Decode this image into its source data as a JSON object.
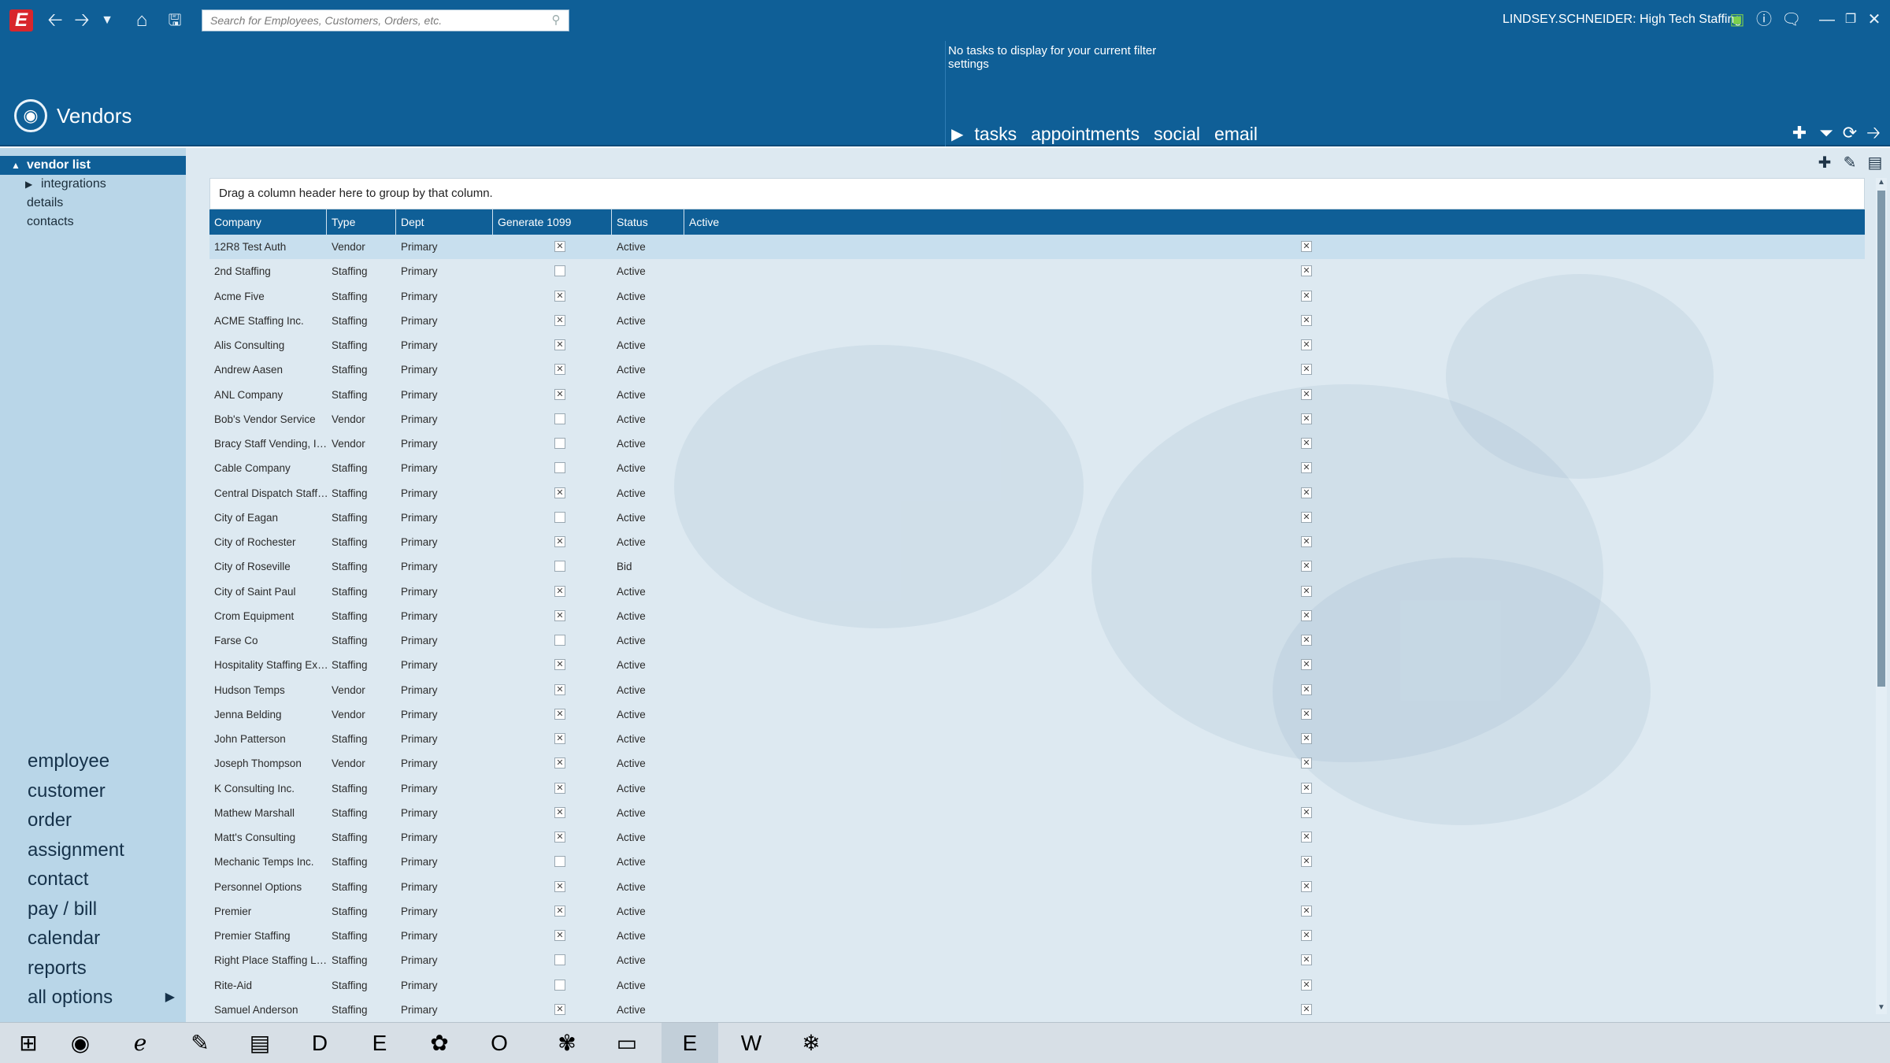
{
  "window": {
    "app_logo": "E",
    "search_placeholder": "Search for Employees, Customers, Orders, etc.",
    "user": "LINDSEY.SCHNEIDER: High Tech Staffing"
  },
  "module": {
    "title": "Vendors"
  },
  "tasks_panel": {
    "message": "No tasks to display for your current filter settings",
    "tabs": [
      "tasks",
      "appointments",
      "social",
      "email"
    ]
  },
  "tree": [
    {
      "label": "vendor list",
      "selected": true,
      "arrow": "▲"
    },
    {
      "label": "integrations",
      "selected": false,
      "arrow": "▶"
    },
    {
      "label": "details",
      "selected": false,
      "arrow": ""
    },
    {
      "label": "contacts",
      "selected": false,
      "arrow": ""
    }
  ],
  "nav": [
    "employee",
    "customer",
    "order",
    "assignment",
    "contact",
    "pay / bill",
    "calendar",
    "reports",
    "all options"
  ],
  "grid": {
    "group_hint": "Drag a column header here to group by that column.",
    "columns": [
      "Company",
      "Type",
      "Dept",
      "Generate 1099",
      "Status",
      "Active"
    ],
    "rows": [
      {
        "company": "12R8 Test Auth",
        "type": "Vendor",
        "dept": "Primary",
        "gen1099": true,
        "status": "Active",
        "active": true
      },
      {
        "company": "2nd Staffing",
        "type": "Staffing",
        "dept": "Primary",
        "gen1099": false,
        "status": "Active",
        "active": true
      },
      {
        "company": "Acme Five",
        "type": "Staffing",
        "dept": "Primary",
        "gen1099": true,
        "status": "Active",
        "active": true
      },
      {
        "company": "ACME Staffing Inc.",
        "type": "Staffing",
        "dept": "Primary",
        "gen1099": true,
        "status": "Active",
        "active": true
      },
      {
        "company": "Alis Consulting",
        "type": "Staffing",
        "dept": "Primary",
        "gen1099": true,
        "status": "Active",
        "active": true
      },
      {
        "company": "Andrew Aasen",
        "type": "Staffing",
        "dept": "Primary",
        "gen1099": true,
        "status": "Active",
        "active": true
      },
      {
        "company": "ANL Company",
        "type": "Staffing",
        "dept": "Primary",
        "gen1099": true,
        "status": "Active",
        "active": true
      },
      {
        "company": "Bob's Vendor Service",
        "type": "Vendor",
        "dept": "Primary",
        "gen1099": false,
        "status": "Active",
        "active": true
      },
      {
        "company": "Bracy Staff Vending, Inc.",
        "type": "Vendor",
        "dept": "Primary",
        "gen1099": false,
        "status": "Active",
        "active": true
      },
      {
        "company": "Cable Company",
        "type": "Staffing",
        "dept": "Primary",
        "gen1099": false,
        "status": "Active",
        "active": true
      },
      {
        "company": "Central Dispatch Staffing",
        "type": "Staffing",
        "dept": "Primary",
        "gen1099": true,
        "status": "Active",
        "active": true
      },
      {
        "company": "City of Eagan",
        "type": "Staffing",
        "dept": "Primary",
        "gen1099": false,
        "status": "Active",
        "active": true
      },
      {
        "company": "City of Rochester",
        "type": "Staffing",
        "dept": "Primary",
        "gen1099": true,
        "status": "Active",
        "active": true
      },
      {
        "company": "City of Roseville",
        "type": "Staffing",
        "dept": "Primary",
        "gen1099": false,
        "status": "Bid",
        "active": true
      },
      {
        "company": "City of Saint Paul",
        "type": "Staffing",
        "dept": "Primary",
        "gen1099": true,
        "status": "Active",
        "active": true
      },
      {
        "company": "Crom Equipment",
        "type": "Staffing",
        "dept": "Primary",
        "gen1099": true,
        "status": "Active",
        "active": true
      },
      {
        "company": "Farse Co",
        "type": "Staffing",
        "dept": "Primary",
        "gen1099": false,
        "status": "Active",
        "active": true
      },
      {
        "company": "Hospitality Staffing Exe...",
        "type": "Staffing",
        "dept": "Primary",
        "gen1099": true,
        "status": "Active",
        "active": true
      },
      {
        "company": "Hudson Temps",
        "type": "Vendor",
        "dept": "Primary",
        "gen1099": true,
        "status": "Active",
        "active": true
      },
      {
        "company": "Jenna Belding",
        "type": "Vendor",
        "dept": "Primary",
        "gen1099": true,
        "status": "Active",
        "active": true
      },
      {
        "company": "John Patterson",
        "type": "Staffing",
        "dept": "Primary",
        "gen1099": true,
        "status": "Active",
        "active": true
      },
      {
        "company": "Joseph Thompson",
        "type": "Vendor",
        "dept": "Primary",
        "gen1099": true,
        "status": "Active",
        "active": true
      },
      {
        "company": "K Consulting Inc.",
        "type": "Staffing",
        "dept": "Primary",
        "gen1099": true,
        "status": "Active",
        "active": true
      },
      {
        "company": "Mathew Marshall",
        "type": "Staffing",
        "dept": "Primary",
        "gen1099": true,
        "status": "Active",
        "active": true
      },
      {
        "company": "Matt's Consulting",
        "type": "Staffing",
        "dept": "Primary",
        "gen1099": true,
        "status": "Active",
        "active": true
      },
      {
        "company": "Mechanic Temps Inc.",
        "type": "Staffing",
        "dept": "Primary",
        "gen1099": false,
        "status": "Active",
        "active": true
      },
      {
        "company": "Personnel Options",
        "type": "Staffing",
        "dept": "Primary",
        "gen1099": true,
        "status": "Active",
        "active": true
      },
      {
        "company": "Premier",
        "type": "Staffing",
        "dept": "Primary",
        "gen1099": true,
        "status": "Active",
        "active": true
      },
      {
        "company": "Premier Staffing",
        "type": "Staffing",
        "dept": "Primary",
        "gen1099": true,
        "status": "Active",
        "active": true
      },
      {
        "company": "Right Place Staffing LLC",
        "type": "Staffing",
        "dept": "Primary",
        "gen1099": false,
        "status": "Active",
        "active": true
      },
      {
        "company": "Rite-Aid",
        "type": "Staffing",
        "dept": "Primary",
        "gen1099": false,
        "status": "Active",
        "active": true
      },
      {
        "company": "Samuel Anderson",
        "type": "Staffing",
        "dept": "Primary",
        "gen1099": true,
        "status": "Active",
        "active": true
      }
    ]
  },
  "taskbar": [
    {
      "name": "start-icon",
      "glyph": "⊞",
      "active": false
    },
    {
      "name": "chrome-icon",
      "glyph": "◉",
      "active": false
    },
    {
      "name": "internet-explorer-icon",
      "glyph": "ℯ",
      "active": false
    },
    {
      "name": "paint-tool-icon",
      "glyph": "✎",
      "active": false
    },
    {
      "name": "file-explorer-icon",
      "glyph": "▤",
      "active": false
    },
    {
      "name": "d-app-icon",
      "glyph": "D",
      "active": false
    },
    {
      "name": "e-app-icon",
      "glyph": "E",
      "active": false
    },
    {
      "name": "paint-palette-icon",
      "glyph": "✿",
      "active": false
    },
    {
      "name": "outlook-icon",
      "glyph": "O",
      "active": false
    },
    {
      "name": "flower-app-icon",
      "glyph": "✾",
      "active": false
    },
    {
      "name": "window-app-icon",
      "glyph": "▭",
      "active": false
    },
    {
      "name": "e-app-active-icon",
      "glyph": "E",
      "active": true
    },
    {
      "name": "word-icon",
      "glyph": "W",
      "active": false
    },
    {
      "name": "snowflake-app-icon",
      "glyph": "❄",
      "active": false
    }
  ]
}
